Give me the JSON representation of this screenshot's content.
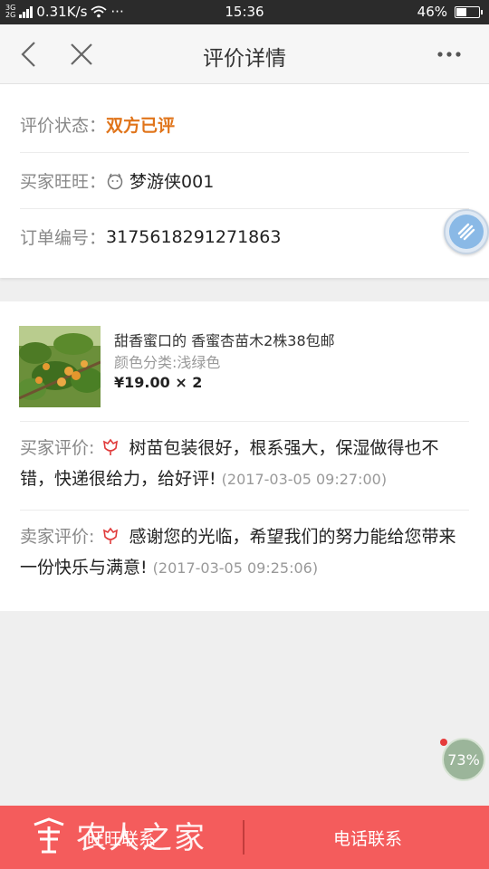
{
  "status_bar": {
    "network_top": "3G",
    "network_bottom": "2G",
    "speed": "0.31K/s",
    "more": "···",
    "time": "15:36",
    "battery": "46%",
    "battery_level": 0.46
  },
  "nav": {
    "title": "评价详情",
    "back_icon": "chevron-left-icon",
    "close_icon": "close-icon",
    "more_icon": "more-icon"
  },
  "info": {
    "status_label": "评价状态：",
    "status_value": "双方已评",
    "buyer_label": "买家旺旺：",
    "buyer_value": "梦游侠001",
    "order_label": "订单编号：",
    "order_value": "3175618291271863",
    "status_color": "#e0741a"
  },
  "product": {
    "title": "甜香蜜口的 香蜜杏苗木2株38包邮",
    "spec": "颜色分类:浅绿色",
    "price": "¥19.00 × 2"
  },
  "reviews": [
    {
      "label": "买家评价:",
      "text": "树苗包装很好，根系强大，保湿做得也不错，快递很给力，给好评!",
      "time": "(2017-03-05 09:27:00)"
    },
    {
      "label": "卖家评价:",
      "text": "感谢您的光临，希望我们的努力能给您带来一份快乐与满意!",
      "time": "(2017-03-05 09:25:06)"
    }
  ],
  "float_widget": {
    "percent": "73%"
  },
  "bottom": {
    "wangwang_label": "旺旺联系",
    "phone_label": "电话联系",
    "watermark": "农人之家",
    "bar_color": "#f45c5c"
  }
}
